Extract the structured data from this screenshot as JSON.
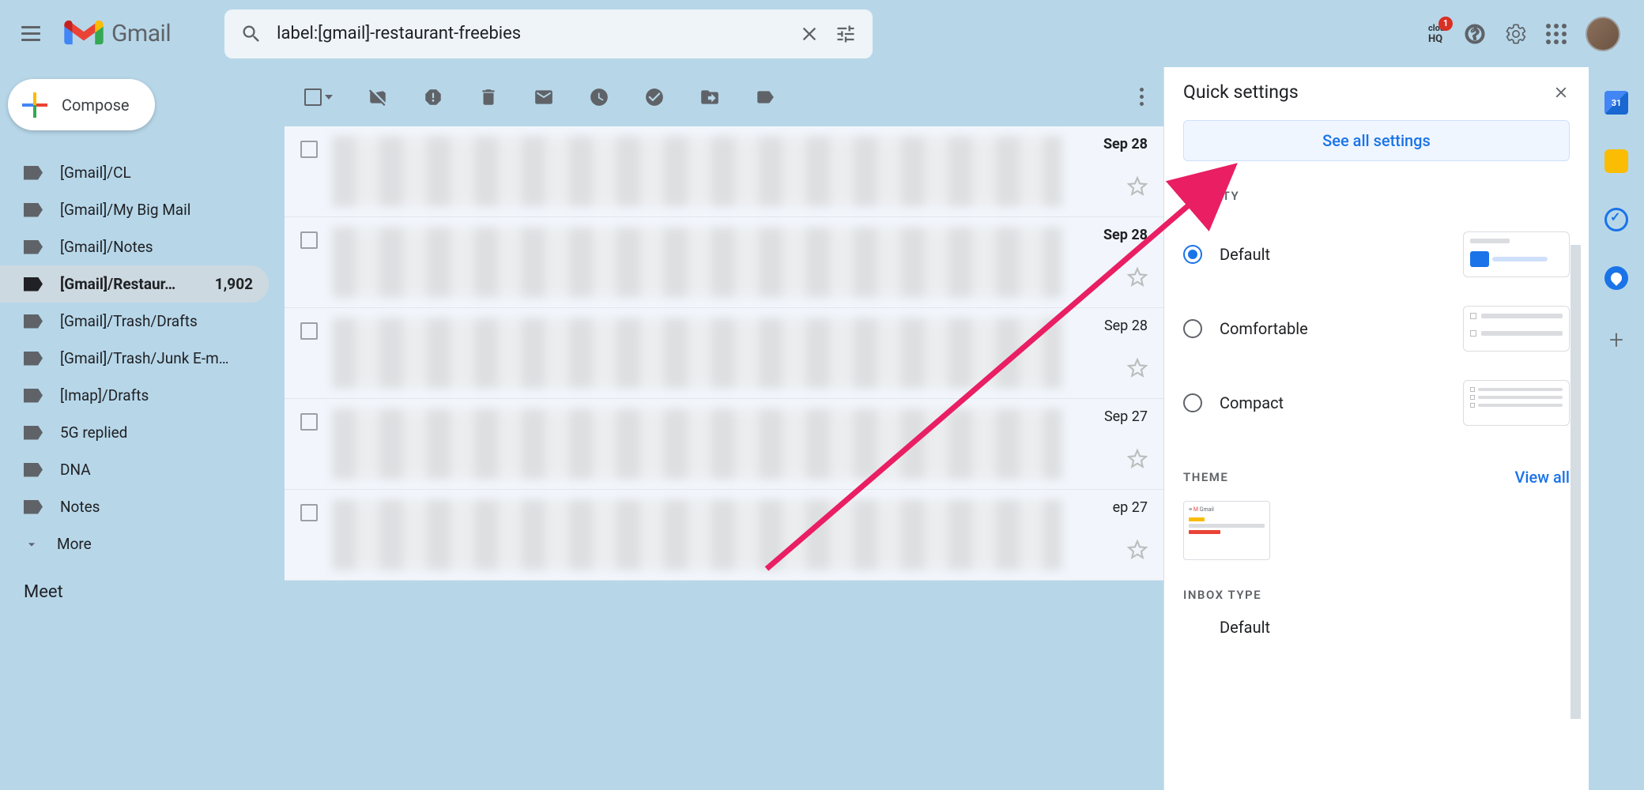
{
  "header": {
    "app_name": "Gmail",
    "search_value": "label:[gmail]-restaurant-freebies",
    "hq_badge": "1",
    "hq_text_top": "clou",
    "hq_text_bottom": "HQ",
    "calendar_day": "31"
  },
  "compose_label": "Compose",
  "sidebar": {
    "labels": [
      {
        "name": "[Gmail]/CL",
        "active": false
      },
      {
        "name": "[Gmail]/My Big Mail",
        "active": false
      },
      {
        "name": "[Gmail]/Notes",
        "active": false
      },
      {
        "name": "[Gmail]/Restaur…",
        "active": true,
        "count": "1,902"
      },
      {
        "name": "[Gmail]/Trash/Drafts",
        "active": false
      },
      {
        "name": "[Gmail]/Trash/Junk E-m…",
        "active": false
      },
      {
        "name": "[Imap]/Drafts",
        "active": false
      },
      {
        "name": "5G replied",
        "active": false
      },
      {
        "name": "DNA",
        "active": false
      },
      {
        "name": "Notes",
        "active": false
      }
    ],
    "more_label": "More",
    "meet_label": "Meet"
  },
  "mail": {
    "rows": [
      {
        "date": "Sep 28",
        "bold": true
      },
      {
        "date": "Sep 28",
        "bold": true
      },
      {
        "date": "Sep 28",
        "bold": false
      },
      {
        "date": "Sep 27",
        "bold": false
      },
      {
        "date": "ep 27",
        "bold": false
      }
    ]
  },
  "settings": {
    "title": "Quick settings",
    "see_all": "See all settings",
    "density_title": "DENSITY",
    "density_options": [
      {
        "label": "Default",
        "checked": true
      },
      {
        "label": "Comfortable",
        "checked": false
      },
      {
        "label": "Compact",
        "checked": false
      }
    ],
    "theme_title": "THEME",
    "view_all": "View all",
    "theme_thumb_text": "M Gmail",
    "inbox_type_title": "INBOX TYPE",
    "inbox_type_option": "Default"
  }
}
